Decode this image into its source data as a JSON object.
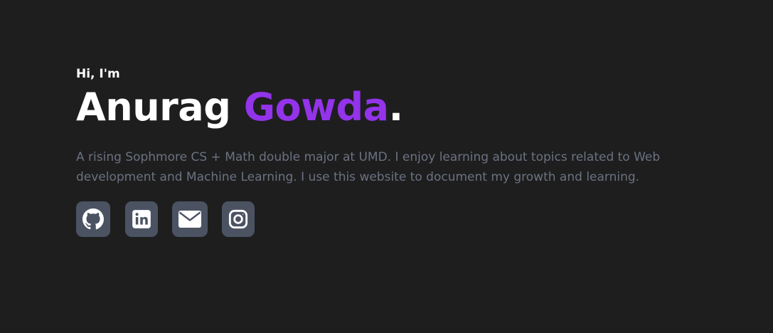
{
  "hero": {
    "greeting": "Hi, I'm",
    "first_name": "Anurag ",
    "last_name": "Gowda",
    "period": ".",
    "bio": "A rising Sophmore CS + Math double major at UMD. I enjoy learning about topics related to Web development and Machine Learning. I use this website to document my growth and learning."
  },
  "socials": [
    {
      "icon": "github-icon"
    },
    {
      "icon": "linkedin-icon"
    },
    {
      "icon": "mail-icon"
    },
    {
      "icon": "instagram-icon"
    }
  ],
  "colors": {
    "background": "#1e1e1f",
    "accent": "#9333ea",
    "muted_text": "#6b7280",
    "icon_button": "#4b5362"
  }
}
